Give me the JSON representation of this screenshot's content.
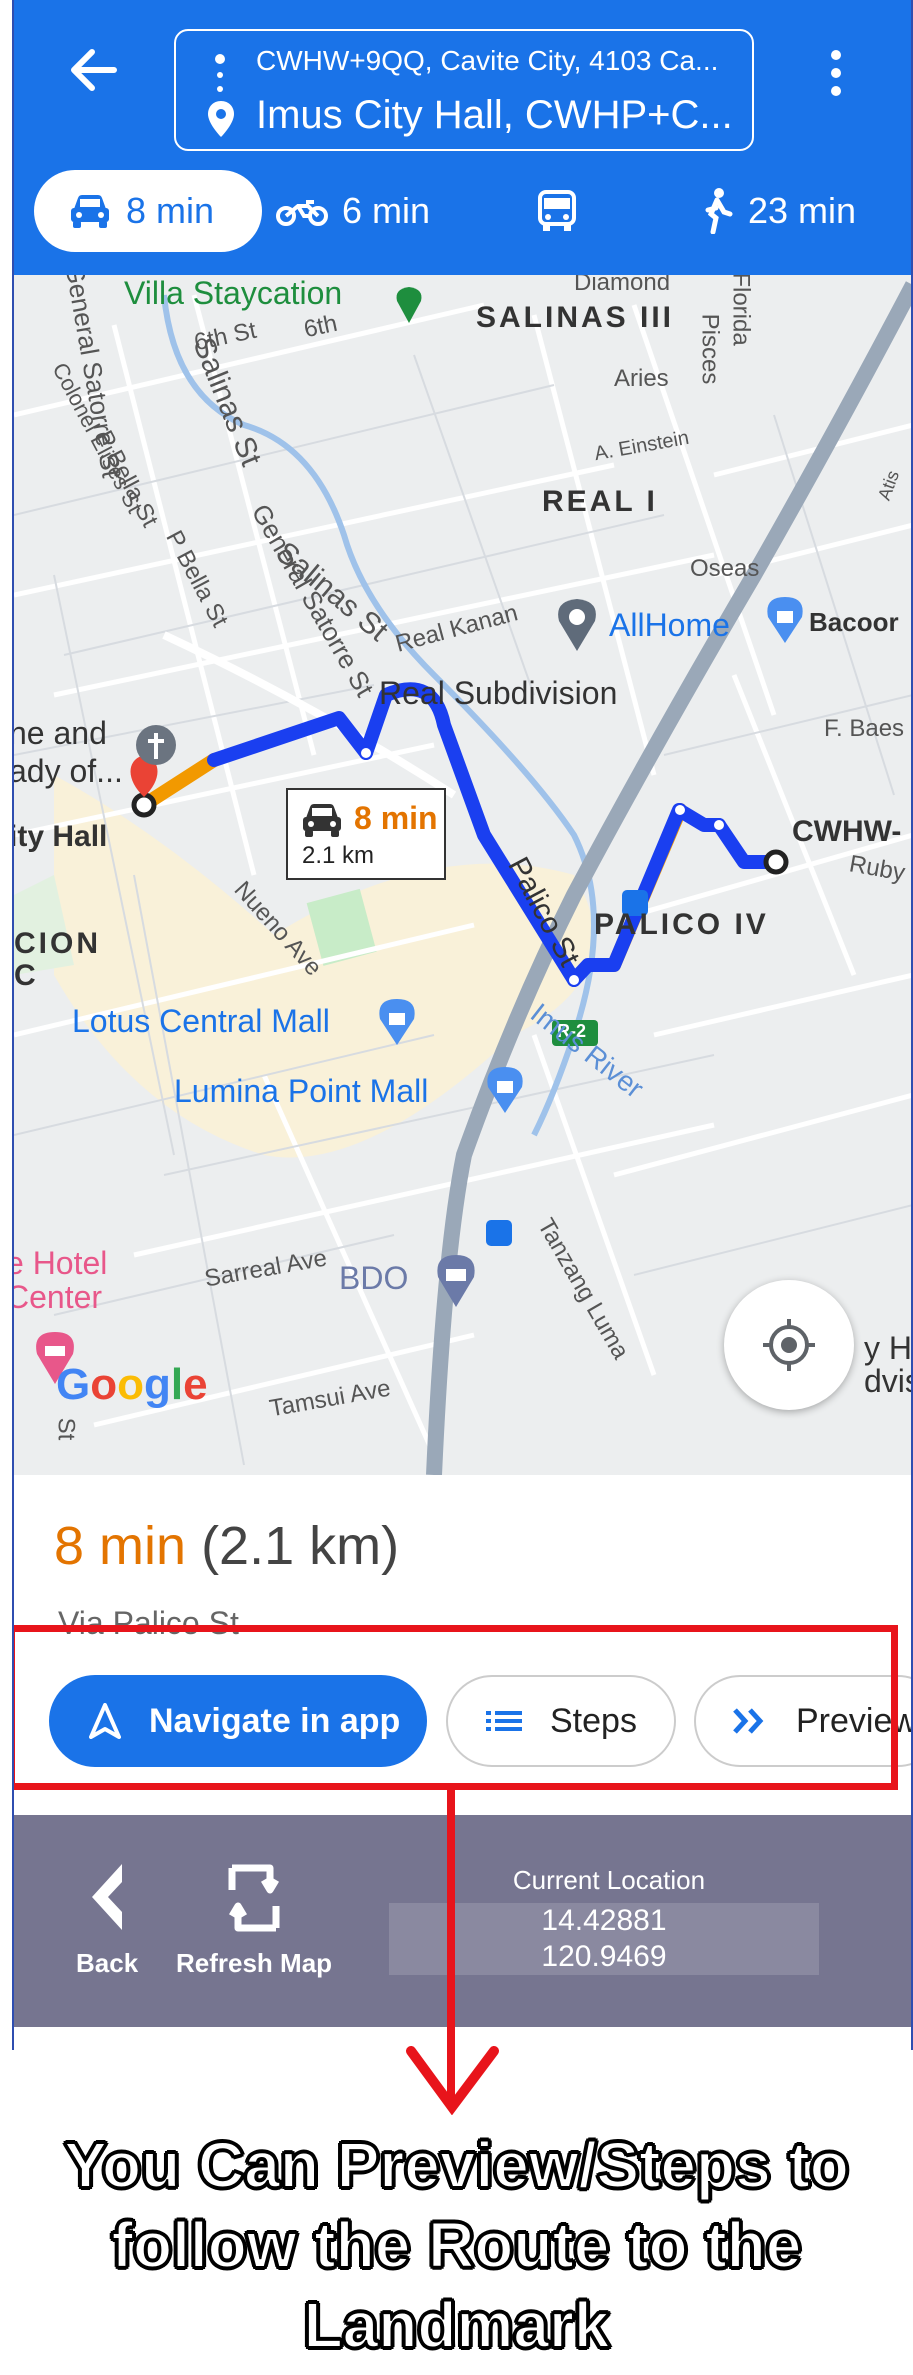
{
  "header": {
    "from_address": "CWHW+9QQ, Cavite City, 4103 Ca...",
    "to_address": "Imus City Hall, CWHP+C..."
  },
  "travel_modes": [
    {
      "icon": "car-icon",
      "label": "8 min",
      "selected": true
    },
    {
      "icon": "motorcycle-icon",
      "label": "6 min",
      "selected": false
    },
    {
      "icon": "transit-icon",
      "label": "",
      "selected": false
    },
    {
      "icon": "walking-icon",
      "label": "23 min",
      "selected": false
    }
  ],
  "map": {
    "labels": {
      "villa_staycation": "Villa Staycation",
      "diamond": "Diamond",
      "florida": "Florida",
      "salinas_iii": "SALINAS III",
      "pisces": "Pisces",
      "aries": "Aries",
      "sixth_st_a": "6th St",
      "sixth_st_b": "6th",
      "gen_satorre_st_left": "General Satorre St",
      "salinas_st": "Salinas St",
      "colonel_elises_st": "Colonel Elises St",
      "p_bella_st_a": "P Bella St",
      "p_bella_st_b": "P Bella St",
      "a_einstein": "A. Einstein",
      "real_i": "REAL I",
      "atis": "Atis",
      "oseas": "Oseas",
      "gen_satorre_st": "General Satorre St",
      "salinas_st_2": "Salinas St",
      "real_kanan": "Real Kanan",
      "allhome": "AllHome",
      "bacoor": "Bacoor",
      "real_subdivision": "Real Subdivision",
      "f_baes": "F. Baes",
      "shrine_a": "ne and",
      "shrine_b": "ady of...",
      "city_hall": "ity Hall",
      "cwhw": "CWHW-",
      "ruby": "Ruby",
      "palico_st": "Palico St",
      "palico_iv": "PALICO IV",
      "nueno_ave": "Nueno Ave",
      "cion_a": "CION",
      "cion_b": "C",
      "r2": "R-2",
      "lotus_central_mall": "Lotus Central Mall",
      "imus_river": "Imus River",
      "lumina_point_mall": "Lumina Point Mall",
      "hotel_a": "e Hotel",
      "hotel_b": "Center",
      "sarreal_ave": "Sarreal Ave",
      "bdo": "BDO",
      "tanzang_luma": "Tanzang Luma",
      "tamsui_ave": "Tamsui Ave",
      "right_edge_a": "y H",
      "right_edge_b": "dvis",
      "bottom_st": "St"
    },
    "eta_bubble": {
      "time": "8 min",
      "distance": "2.1 km"
    },
    "google_logo": "Google"
  },
  "route": {
    "duration": "8 min",
    "distance": "(2.1 km)",
    "via": "Via Palico St"
  },
  "actions": {
    "navigate_label": "Navigate in app",
    "steps_label": "Steps",
    "preview_label": "Preview"
  },
  "bottom_bar": {
    "back_label": "Back",
    "refresh_label": "Refresh Map",
    "location_title": "Current Location",
    "latitude": "14.42881",
    "longitude": "120.9469"
  },
  "annotation": {
    "instruction": "You Can Preview/Steps to follow the Route to the Landmark"
  },
  "colors": {
    "primary": "#1a73e8",
    "route": "#1a3ff0",
    "traffic": "#f29900",
    "highlight": "#e8141b",
    "bottom_bar": "#767590"
  }
}
